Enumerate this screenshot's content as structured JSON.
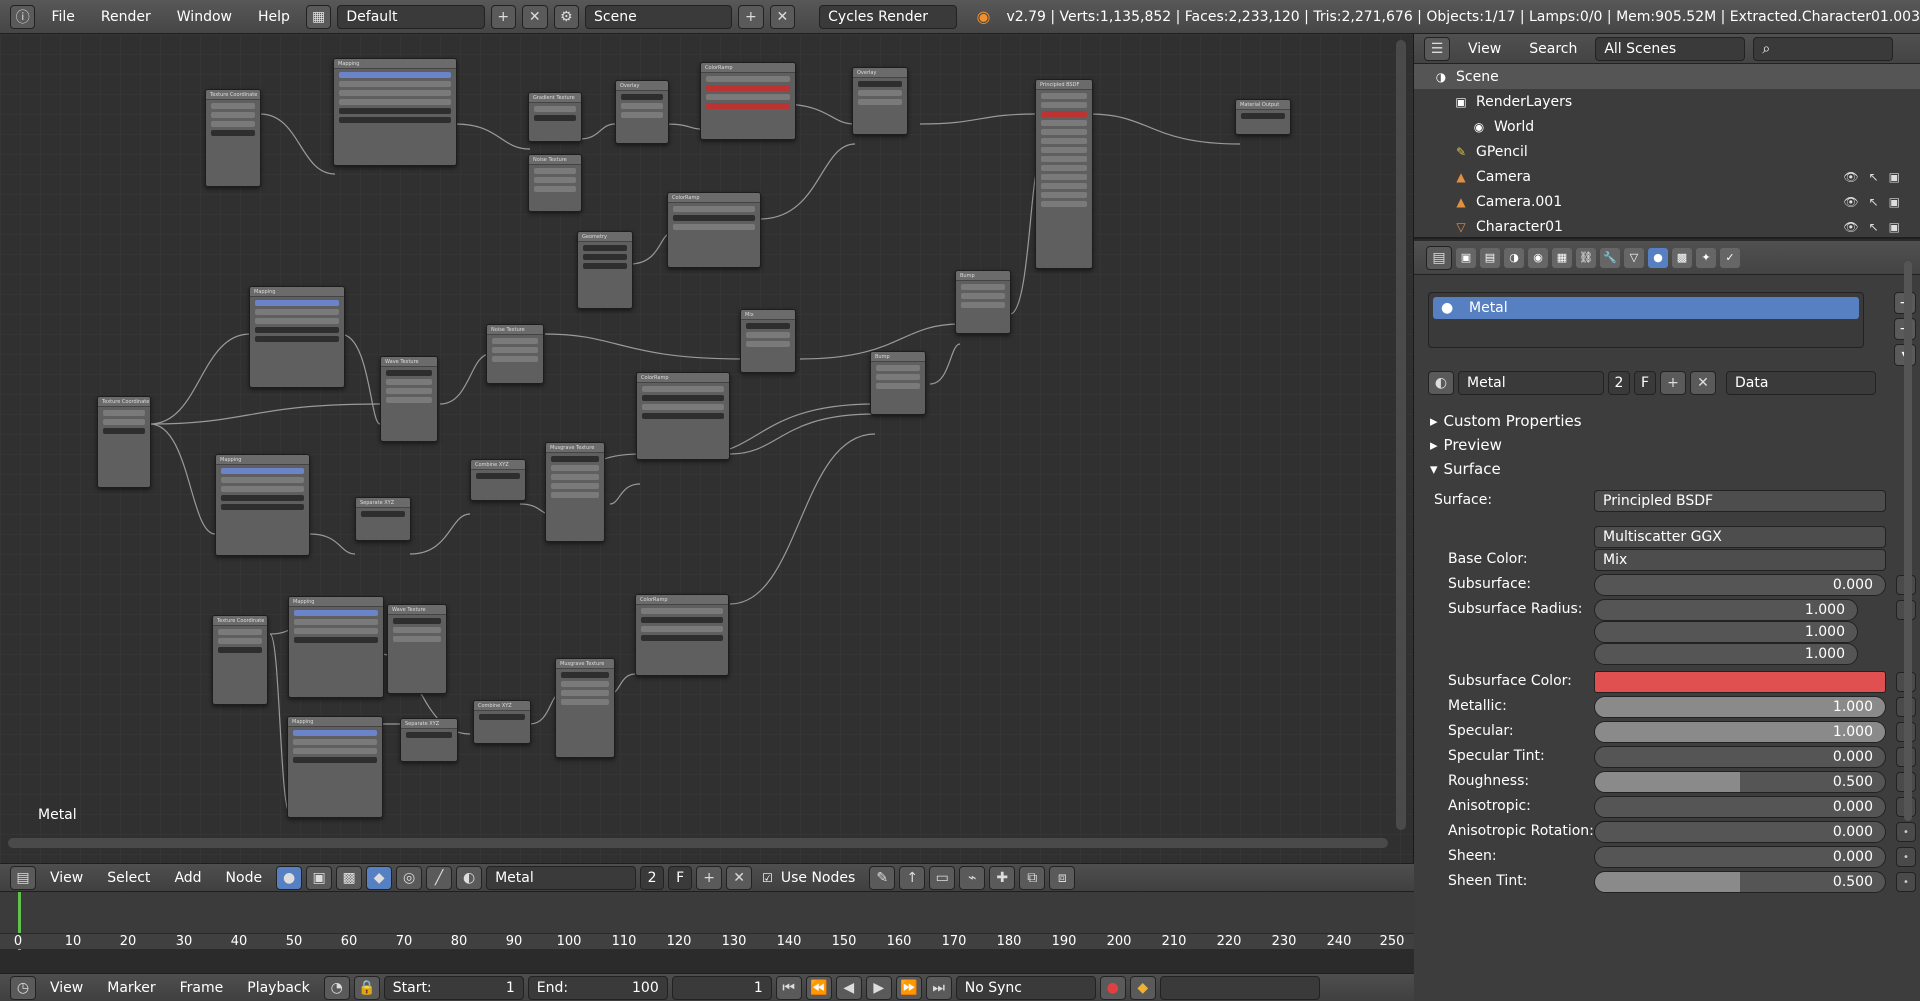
{
  "topbar": {
    "menus": [
      "File",
      "Render",
      "Window",
      "Help"
    ],
    "layout": "Default",
    "scene": "Scene",
    "engine": "Cycles Render",
    "stats": "v2.79 | Verts:1,135,852 | Faces:2,233,120 | Tris:2,271,676 | Objects:1/17 | Lamps:0/0 | Mem:905.52M | Extracted.Character01.003"
  },
  "editor": {
    "label": "Metal"
  },
  "node_header": {
    "menus": [
      "View",
      "Select",
      "Add",
      "Node"
    ],
    "material": "Metal",
    "users": "2",
    "fake": "F",
    "use_nodes": "Use Nodes"
  },
  "timeline": {
    "ticks": [
      "0",
      "10",
      "20",
      "30",
      "40",
      "50",
      "60",
      "70",
      "80",
      "90",
      "100",
      "110",
      "120",
      "130",
      "140",
      "150",
      "160",
      "170",
      "180",
      "190",
      "200",
      "210",
      "220",
      "230",
      "240",
      "250"
    ],
    "menus": [
      "View",
      "Marker",
      "Frame",
      "Playback"
    ],
    "start_label": "Start:",
    "start": "1",
    "end_label": "End:",
    "end": "100",
    "current": "1",
    "sync": "No Sync"
  },
  "outliner": {
    "menus": [
      "View",
      "Search"
    ],
    "filter": "All Scenes",
    "items": [
      {
        "label": "Scene",
        "icon": "scene-icon"
      },
      {
        "label": "RenderLayers",
        "icon": "renderlayers-icon"
      },
      {
        "label": "World",
        "icon": "world-icon"
      },
      {
        "label": "GPencil",
        "icon": "gpencil-icon"
      },
      {
        "label": "Camera",
        "icon": "camera-icon"
      },
      {
        "label": "Camera.001",
        "icon": "camera-icon"
      },
      {
        "label": "Character01",
        "icon": "mesh-icon"
      }
    ]
  },
  "properties": {
    "slot": "Metal",
    "material_name": "Metal",
    "users": "2",
    "fake": "F",
    "link": "Data",
    "panels": [
      "Custom Properties",
      "Preview",
      "Surface"
    ],
    "surface_label": "Surface:",
    "surface": "Principled BSDF",
    "distribution": "Multiscatter GGX",
    "fields": [
      {
        "label": "Base Color:",
        "value": "Mix",
        "kind": "menu"
      },
      {
        "label": "Subsurface:",
        "value": "0.000",
        "fill": 0.0
      },
      {
        "label": "Subsurface Radius:",
        "value": "1.000",
        "fill": 0.0
      },
      {
        "label": "",
        "value": "1.000",
        "fill": 0.0
      },
      {
        "label": "",
        "value": "1.000",
        "fill": 0.0
      },
      {
        "label": "Subsurface Color:",
        "value": "",
        "color": "#e05050"
      },
      {
        "label": "Metallic:",
        "value": "1.000",
        "fill": 1.0
      },
      {
        "label": "Specular:",
        "value": "1.000",
        "fill": 1.0
      },
      {
        "label": "Specular Tint:",
        "value": "0.000",
        "fill": 0.0
      },
      {
        "label": "Roughness:",
        "value": "0.500",
        "fill": 0.5
      },
      {
        "label": "Anisotropic:",
        "value": "0.000",
        "fill": 0.0
      },
      {
        "label": "Anisotropic Rotation:",
        "value": "0.000",
        "fill": 0.0
      },
      {
        "label": "Sheen:",
        "value": "0.000",
        "fill": 0.0
      },
      {
        "label": "Sheen Tint:",
        "value": "0.500",
        "fill": 0.5
      }
    ]
  },
  "colors": {
    "accent": "#5680c2",
    "subsurface": "#e05050",
    "playhead": "#5fc24a"
  }
}
